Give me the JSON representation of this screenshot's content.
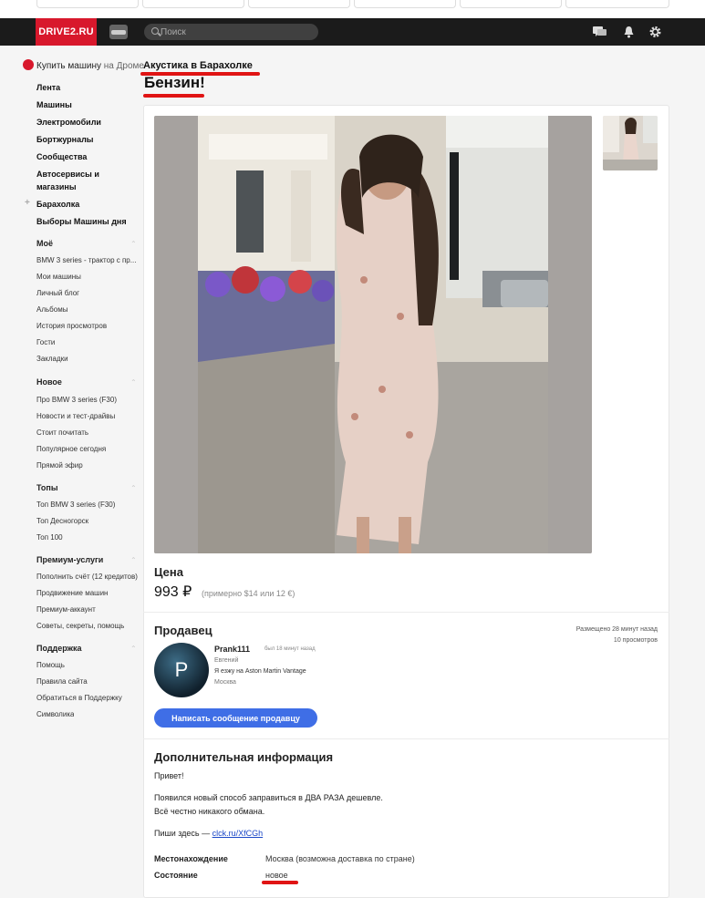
{
  "header": {
    "logo": "DRIVE2.RU",
    "search_placeholder": "Поиск"
  },
  "sidebar": {
    "drom_link": "Купить машину",
    "drom_suffix": "на Дроме",
    "main_items": [
      "Лента",
      "Машины",
      "Электромобили",
      "Бортжурналы",
      "Сообщества",
      "Автосервисы и",
      "магазины",
      "Барахолка",
      "Выборы Машины дня"
    ],
    "sections": [
      {
        "title": "Моё",
        "items": [
          "BMW 3 series - трактор с пр...",
          "Мои машины",
          "Личный блог",
          "Альбомы",
          "История просмотров",
          "Гости",
          "Закладки"
        ]
      },
      {
        "title": "Новое",
        "items": [
          "Про BMW 3 series (F30)",
          "Новости и тест-драйвы",
          "Стоит почитать",
          "Популярное сегодня",
          "Прямой эфир"
        ]
      },
      {
        "title": "Топы",
        "items": [
          "Топ BMW 3 series (F30)",
          "Топ Десногорск",
          "Топ 100"
        ]
      },
      {
        "title": "Премиум-услуги",
        "items": [
          "Пополнить счёт (12 кредитов)",
          "Продвижение машин",
          "Премиум-аккаунт",
          "Советы, секреты, помощь"
        ]
      },
      {
        "title": "Поддержка",
        "items": [
          "Помощь",
          "Правила сайта",
          "Обратиться в Поддержку",
          "Символика"
        ]
      }
    ]
  },
  "listing": {
    "breadcrumb": "Акустика в Барахолке",
    "title": "Бензин!",
    "price_label": "Цена",
    "price": "993 ₽",
    "price_alt": "(примерно $14 или 12 €)",
    "seller_label": "Продавец",
    "posted": "Размещено 28 минут назад",
    "views": "10 просмотров",
    "seller": {
      "avatar_letter": "P",
      "username": "Prank111",
      "last_seen": "был 18 минут назад",
      "name": "Евгений",
      "car": "Я езжу на Aston Martin Vantage",
      "city": "Москва"
    },
    "message_button": "Написать сообщение продавцу",
    "info_title": "Дополнительная информация",
    "description": [
      "Привет!",
      "Появился новый способ заправиться в ДВА РАЗА дешевле.",
      "Всё честно никакого обмана.",
      "Пиши здесь — "
    ],
    "link": "clck.ru/XfCGh",
    "specs": [
      {
        "key": "Местонахождение",
        "value": "Москва (возможна доставка по стране)"
      },
      {
        "key": "Состояние",
        "value": "новое"
      }
    ]
  },
  "colors": {
    "brand": "#d8182c",
    "button": "#3f6ee6",
    "annotation": "#e01414"
  }
}
